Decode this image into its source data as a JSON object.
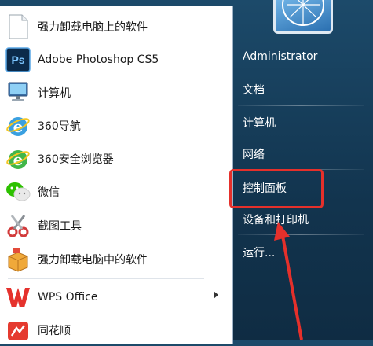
{
  "programs": [
    {
      "label": "强力卸载电脑上的软件",
      "icon": "blank-document-icon"
    },
    {
      "label": "Adobe Photoshop CS5",
      "icon": "photoshop-icon",
      "icon_text": "Ps"
    },
    {
      "label": "计算机",
      "icon": "computer-icon"
    },
    {
      "label": "360导航",
      "icon": "ie-360-icon"
    },
    {
      "label": "360安全浏览器",
      "icon": "360-browser-icon"
    },
    {
      "label": "微信",
      "icon": "wechat-icon"
    },
    {
      "label": "截图工具",
      "icon": "scissors-icon"
    },
    {
      "label": "强力卸载电脑中的软件",
      "icon": "uninstaller-box-icon"
    },
    {
      "label": "WPS Office",
      "icon": "wps-icon"
    },
    {
      "label": "同花顺",
      "icon": "tonghuashun-icon"
    }
  ],
  "right_menu": {
    "user": "Administrator",
    "documents": "文档",
    "computer": "计算机",
    "network": "网络",
    "control_panel": "控制面板",
    "devices": "设备和打印机",
    "run": "运行..."
  },
  "colors": {
    "highlight": "#e5302b",
    "wallpaper": "#173f5c",
    "photoshop": "#0b2a4a",
    "wps": "#e5322d"
  }
}
